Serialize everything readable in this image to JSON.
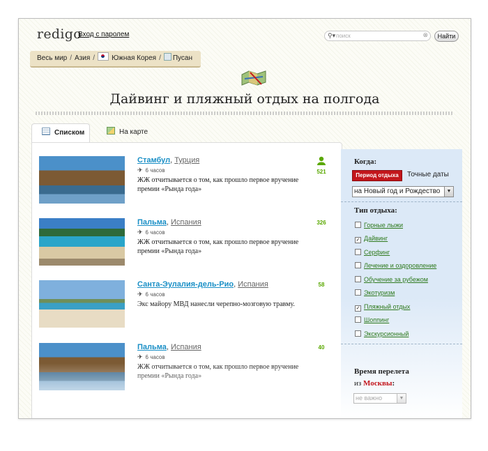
{
  "header": {
    "logo": "redigo",
    "login_link": "Вход с паролем",
    "search_placeholder": "поиск",
    "find_button": "Найти"
  },
  "breadcrumb": {
    "items": [
      "Весь мир",
      "Азия",
      "Южная Корея",
      "Пусан"
    ]
  },
  "page_title": "Дайвинг и пляжный отдых на полгода",
  "tabs": [
    {
      "label": "Списком",
      "active": true
    },
    {
      "label": "На карте",
      "active": false
    }
  ],
  "results": [
    {
      "city": "Стамбул",
      "country": "Турция",
      "flight": "6 часов",
      "description": "ЖЖ отчитывается о том, как прошло первое вручение премии «Рында года»",
      "count": "521"
    },
    {
      "city": "Пальма",
      "country": "Испания",
      "flight": "6 часов",
      "description": "ЖЖ отчитывается о том, как прошло первое вручение премии «Рында года»",
      "count": "326"
    },
    {
      "city": "Санта-Эулалия-дель-Рио",
      "country": "Испания",
      "flight": "6 часов",
      "description": "Экс майору МВД нанесли черепно-мозговую травму.",
      "count": "58"
    },
    {
      "city": "Пальма",
      "country": "Испания",
      "flight": "6 часов",
      "description": "ЖЖ отчитывается о том, как прошло первое вручение премии «Рында года»",
      "count": "40"
    }
  ],
  "sidebar": {
    "when_heading": "Когда:",
    "period_button": "Период отдыха",
    "exact_dates": "Точные даты",
    "when_select": "на Новый год и Рождество",
    "type_heading": "Тип отдыха:",
    "types": [
      {
        "label": "Горные лыжи",
        "checked": false
      },
      {
        "label": "Дайвинг",
        "checked": true
      },
      {
        "label": "Серфинг",
        "checked": false
      },
      {
        "label": "Лечение и оздоровление",
        "checked": false
      },
      {
        "label": "Обучение за рубежом",
        "checked": false
      },
      {
        "label": "Экотуризм",
        "checked": false
      },
      {
        "label": "Пляжный отдых",
        "checked": true
      },
      {
        "label": "Шоппинг",
        "checked": false
      },
      {
        "label": "Экскурсионный",
        "checked": false
      }
    ],
    "flight_heading": "Время перелета",
    "from_prefix": "из",
    "from_city": "Москвы",
    "from_suffix": ":",
    "time_select": "не важно"
  },
  "colors": {
    "accent_red": "#c3161c",
    "link_blue": "#1a8fc6",
    "link_green": "#2f7a1e",
    "count_green": "#5aa800",
    "sidebar_bg": "#dce9f7",
    "breadcrumb_bg": "#ece2c6"
  },
  "icons": [
    "search-icon",
    "clear-icon",
    "flag-icon",
    "city-icon",
    "map-icon",
    "list-icon",
    "map-tab-icon",
    "plane-icon",
    "user-icon",
    "chevron-down-icon",
    "checkbox-icon"
  ]
}
